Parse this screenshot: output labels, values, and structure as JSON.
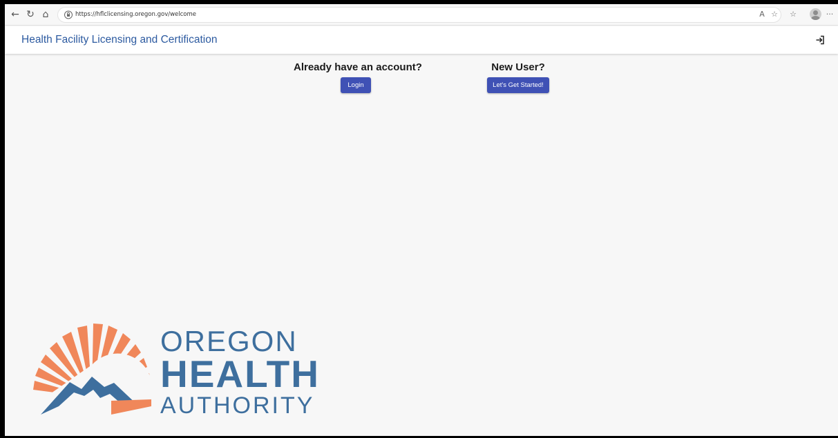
{
  "browser": {
    "url": "https://hflclicensing.oregon.gov/welcome",
    "back_icon": "back-arrow-icon",
    "refresh_icon": "refresh-icon",
    "home_icon": "home-icon"
  },
  "header": {
    "title": "Health Facility Licensing and Certification",
    "logout_icon": "sign-in-icon"
  },
  "welcome": {
    "existing_heading": "Already have an account?",
    "login_label": "Login",
    "new_heading": "New User?",
    "start_label": "Let's Get Started!"
  },
  "logo": {
    "line1": "OREGON",
    "line2": "HEALTH",
    "line3": "AUTHORITY"
  },
  "colors": {
    "accent": "#3f51b5",
    "title": "#2c5aa0",
    "logo_blue": "#3e6f9e",
    "logo_orange": "#f0875a"
  }
}
